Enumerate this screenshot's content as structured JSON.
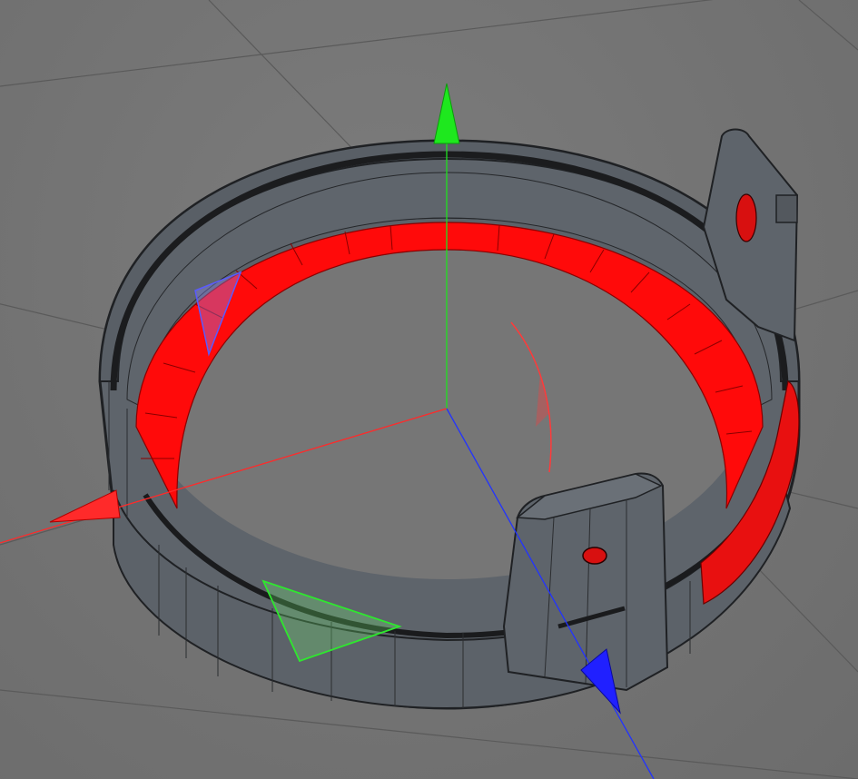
{
  "viewport": {
    "background_color": "#767676",
    "grid_color": "#5a5a5a",
    "axis_colors": {
      "x": "#ff2a2a",
      "y": "#1fe01f",
      "z": "#2233ff"
    },
    "selection_color": "#ff0000",
    "mesh_color": "#5e646b",
    "edge_color": "#202224"
  },
  "gizmo": {
    "move_x_handle": "move-x-arrow-icon",
    "move_y_handle": "move-y-arrow-icon",
    "move_z_handle": "move-z-arrow-icon",
    "plane_xy_handle": "plane-xy-handle-icon",
    "plane_xz_handle": "plane-xz-handle-icon",
    "plane_yz_handle": "plane-yz-handle-icon",
    "rotation_arc": "rotation-arc-icon"
  },
  "model": {
    "object": "ring-with-tabs",
    "selected_faces": "inner-band"
  }
}
